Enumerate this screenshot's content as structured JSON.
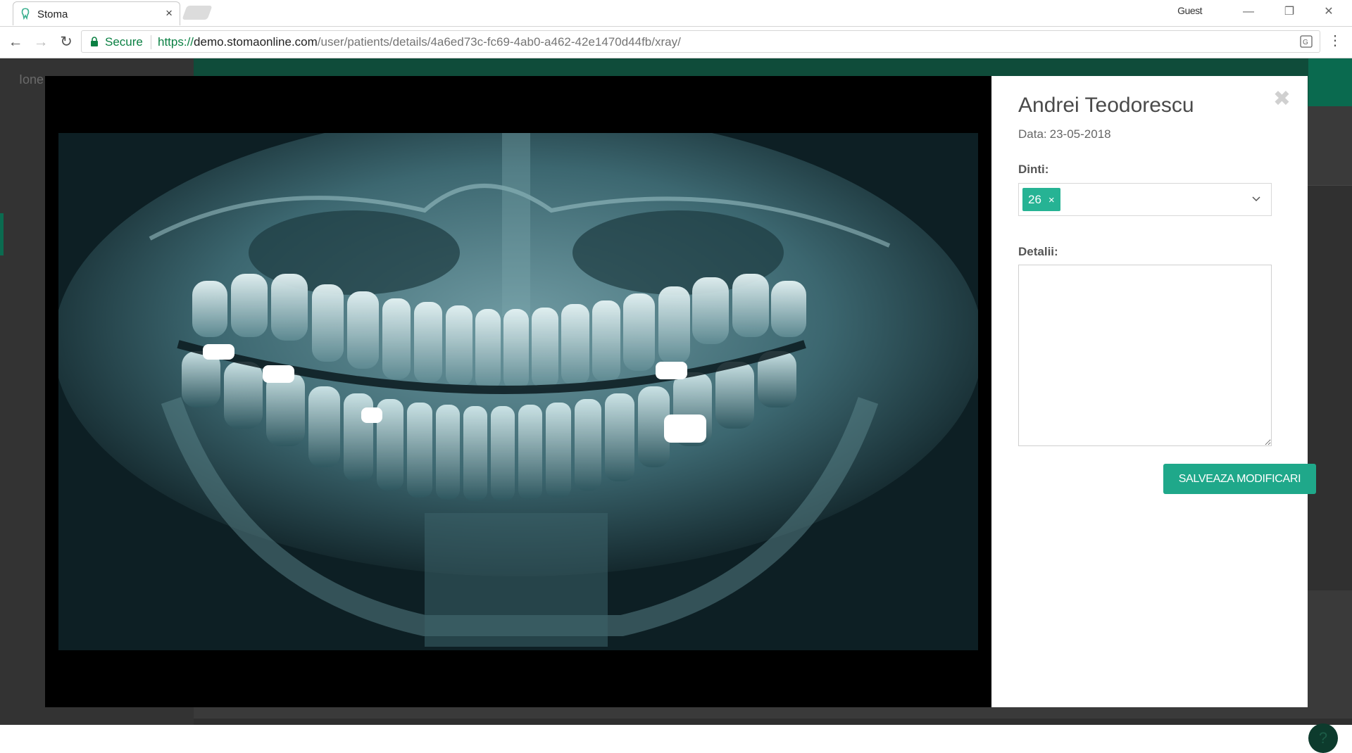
{
  "browser": {
    "tab_title": "Stoma",
    "tab_close": "×",
    "profile": "Guest",
    "secure_label": "Secure",
    "url_scheme": "https://",
    "url_host": "demo.stomaonline.com",
    "url_path": "/user/patients/details/4a6ed73c-fc69-4ab0-a462-42e1470d44fb/xray/",
    "nav_back": "←",
    "nav_forward": "→",
    "nav_reload": "↻",
    "menu": "⋮",
    "win_min": "—",
    "win_max": "❐",
    "win_close": "✕"
  },
  "page": {
    "user_partial": "Ione"
  },
  "modal": {
    "close_glyph": "✖",
    "patient_name": "Andrei Teodorescu",
    "date_label": "Data:",
    "date_value": "23-05-2018",
    "teeth_label": "Dinti:",
    "teeth_tags": [
      "26"
    ],
    "tag_remove": "×",
    "details_label": "Detalii:",
    "details_value": "",
    "save_button": "SALVEAZA MODIFICARI"
  },
  "colors": {
    "accent": "#1fa88a",
    "tag": "#26b394",
    "secure_green": "#0b8043"
  }
}
